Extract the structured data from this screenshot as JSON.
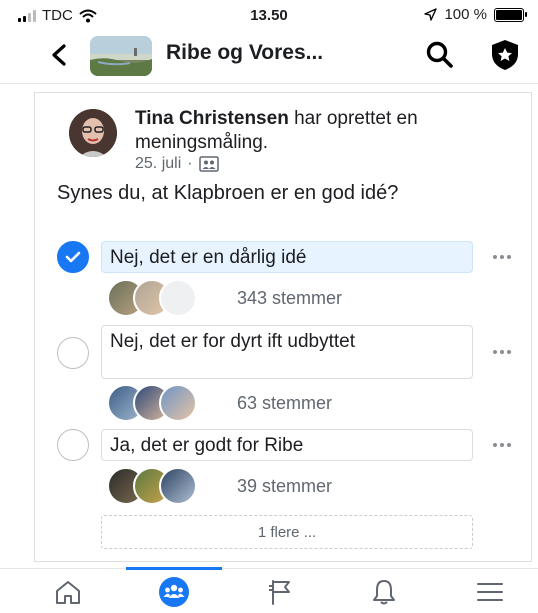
{
  "status_bar": {
    "carrier": "TDC",
    "time": "13.50",
    "battery": "100 %"
  },
  "header": {
    "title": "Ribe og Vores..."
  },
  "post": {
    "author": "Tina Christensen",
    "action": "har oprettet en meningsmåling.",
    "date": "25. juli",
    "separator": "·",
    "question": "Synes du, at Klapbroen er en god idé?",
    "options": [
      {
        "label": "Nej, det er en dårlig idé",
        "votes": "343 stemmer",
        "selected": true
      },
      {
        "label": "Nej, det er for dyrt ift udbyttet",
        "votes": "63 stemmer",
        "selected": false
      },
      {
        "label": "Ja, det er godt for Ribe",
        "votes": "39 stemmer",
        "selected": false
      }
    ],
    "more_options": "1 flere ..."
  },
  "bottom_nav": {
    "items": [
      "home-icon",
      "groups-icon",
      "pages-flag-icon",
      "notifications-bell-icon",
      "menu-icon"
    ],
    "active": "groups-icon"
  },
  "colors": {
    "accent": "#1877f2",
    "selected_bg": "#e7f3ff",
    "secondary_text": "#606770"
  }
}
